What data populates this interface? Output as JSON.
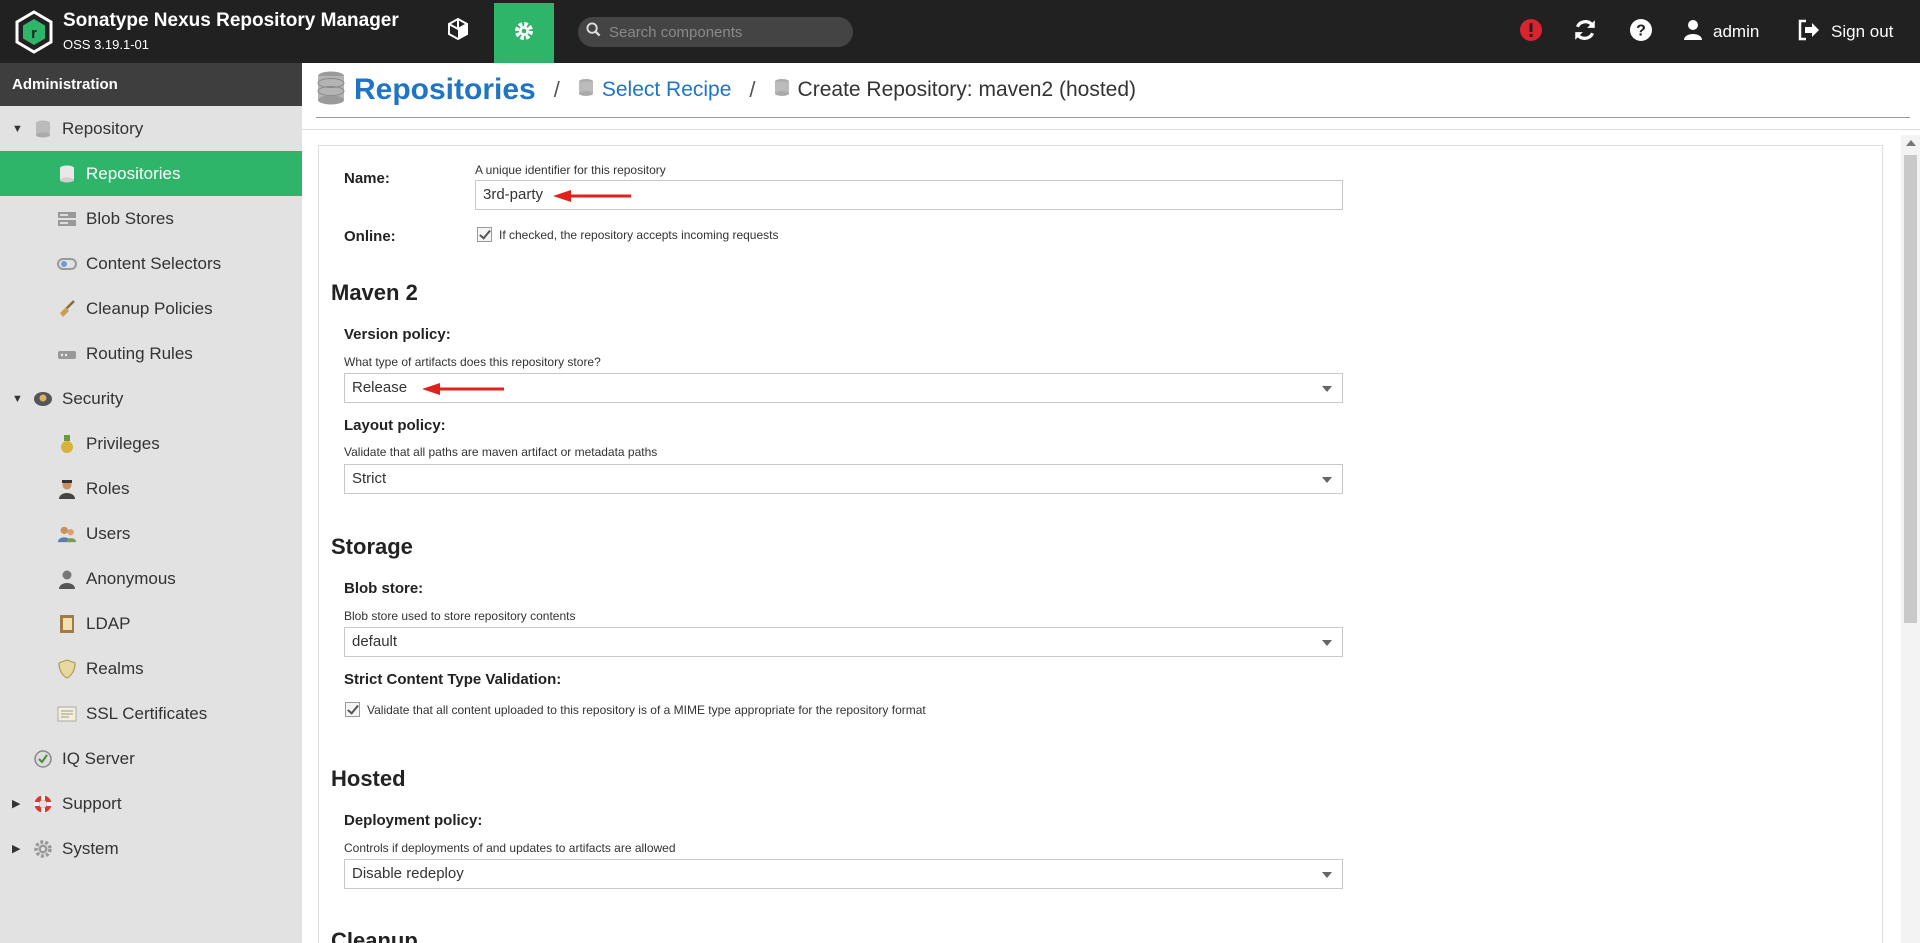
{
  "header": {
    "title": "Sonatype Nexus Repository Manager",
    "version": "OSS 3.19.1-01",
    "search_placeholder": "Search components",
    "user": "admin",
    "signout": "Sign out"
  },
  "sidebar": {
    "heading": "Administration",
    "items": [
      {
        "label": "Repository"
      },
      {
        "label": "Repositories"
      },
      {
        "label": "Blob Stores"
      },
      {
        "label": "Content Selectors"
      },
      {
        "label": "Cleanup Policies"
      },
      {
        "label": "Routing Rules"
      },
      {
        "label": "Security"
      },
      {
        "label": "Privileges"
      },
      {
        "label": "Roles"
      },
      {
        "label": "Users"
      },
      {
        "label": "Anonymous"
      },
      {
        "label": "LDAP"
      },
      {
        "label": "Realms"
      },
      {
        "label": "SSL Certificates"
      },
      {
        "label": "IQ Server"
      },
      {
        "label": "Support"
      },
      {
        "label": "System"
      }
    ]
  },
  "breadcrumb": {
    "title": "Repositories",
    "sep": "/",
    "recipe": "Select Recipe",
    "current": "Create Repository: maven2 (hosted)"
  },
  "form": {
    "name_label": "Name:",
    "name_help": "A unique identifier for this repository",
    "name_value": "3rd-party",
    "online_label": "Online:",
    "online_help": "If checked, the repository accepts incoming requests",
    "maven_heading": "Maven 2",
    "version_label": "Version policy:",
    "version_help": "What type of artifacts does this repository store?",
    "version_value": "Release",
    "layout_label": "Layout policy:",
    "layout_help": "Validate that all paths are maven artifact or metadata paths",
    "layout_value": "Strict",
    "storage_heading": "Storage",
    "blob_label": "Blob store:",
    "blob_help": "Blob store used to store repository contents",
    "blob_value": "default",
    "strict_label": "Strict Content Type Validation:",
    "strict_help": "Validate that all content uploaded to this repository is of a MIME type appropriate for the repository format",
    "hosted_heading": "Hosted",
    "deploy_label": "Deployment policy:",
    "deploy_help": "Controls if deployments of and updates to artifacts are allowed",
    "deploy_value": "Disable redeploy",
    "cleanup_heading": "Cleanup"
  },
  "colors": {
    "accent": "#2fb56a",
    "link": "#1f74c4",
    "header_bg": "#212121",
    "annotation_arrow": "#e0201a"
  }
}
